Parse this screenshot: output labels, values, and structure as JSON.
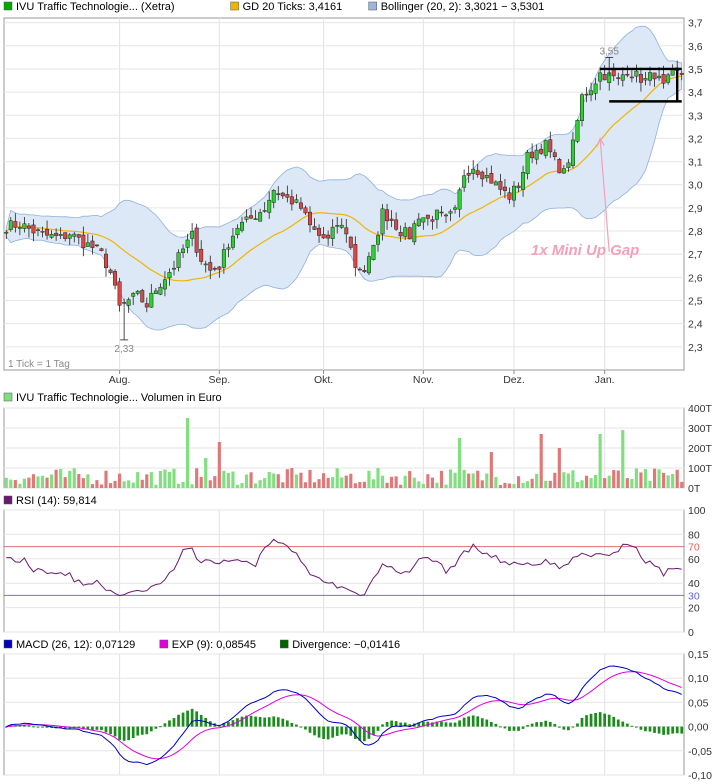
{
  "chart_data": [
    {
      "type": "candlestick",
      "legend": [
        {
          "name": "IVU Traffic Technologie... (Xetra)",
          "color": "#00aa00"
        },
        {
          "name": "GD 20 Ticks: 3,4161",
          "color": "#f0b400"
        },
        {
          "name": "Bollinger (20, 2): 3,3021 − 3,5301",
          "color": "#9bb6dc"
        }
      ],
      "tick_label": "1 Tick = 1 Tag",
      "y_ticks": [
        "3,7",
        "3,6",
        "3,5",
        "3,4",
        "3,3",
        "3,2",
        "3,1",
        "3,0",
        "2,9",
        "2,8",
        "2,7",
        "2,6",
        "2,5",
        "2,4",
        "2,3"
      ],
      "y_values": [
        3.7,
        3.6,
        3.5,
        3.4,
        3.3,
        3.2,
        3.1,
        3.0,
        2.9,
        2.8,
        2.7,
        2.6,
        2.5,
        2.4,
        2.3
      ],
      "ylim": [
        2.2,
        3.72
      ],
      "x_ticks": [
        "Aug.",
        "Sep.",
        "Okt.",
        "Nov.",
        "Dez.",
        "Jan."
      ],
      "x_tick_index": [
        25,
        47,
        70,
        92,
        112,
        132
      ],
      "annotations": {
        "low": "2,33",
        "high": "3,55",
        "text": "1x Mini Up Gap"
      },
      "anchors": [
        [
          0,
          2.82
        ],
        [
          3,
          2.83
        ],
        [
          6,
          2.8
        ],
        [
          9,
          2.78
        ],
        [
          12,
          2.77
        ],
        [
          14,
          2.79
        ],
        [
          17,
          2.75
        ],
        [
          19,
          2.73
        ],
        [
          21,
          2.7
        ],
        [
          23,
          2.62
        ],
        [
          25,
          2.47
        ],
        [
          27,
          2.5
        ],
        [
          29,
          2.52
        ],
        [
          31,
          2.48
        ],
        [
          33,
          2.55
        ],
        [
          35,
          2.6
        ],
        [
          37,
          2.65
        ],
        [
          39,
          2.72
        ],
        [
          41,
          2.78
        ],
        [
          43,
          2.68
        ],
        [
          45,
          2.63
        ],
        [
          47,
          2.65
        ],
        [
          49,
          2.75
        ],
        [
          51,
          2.82
        ],
        [
          53,
          2.84
        ],
        [
          55,
          2.87
        ],
        [
          57,
          2.9
        ],
        [
          59,
          2.98
        ],
        [
          61,
          2.95
        ],
        [
          63,
          2.93
        ],
        [
          65,
          2.9
        ],
        [
          67,
          2.82
        ],
        [
          69,
          2.78
        ],
        [
          71,
          2.76
        ],
        [
          73,
          2.83
        ],
        [
          75,
          2.8
        ],
        [
          77,
          2.65
        ],
        [
          79,
          2.63
        ],
        [
          81,
          2.72
        ],
        [
          83,
          2.88
        ],
        [
          85,
          2.85
        ],
        [
          87,
          2.8
        ],
        [
          89,
          2.78
        ],
        [
          91,
          2.87
        ],
        [
          93,
          2.85
        ],
        [
          95,
          2.87
        ],
        [
          97,
          2.85
        ],
        [
          99,
          2.88
        ],
        [
          101,
          3.05
        ],
        [
          103,
          3.08
        ],
        [
          105,
          3.05
        ],
        [
          107,
          3.02
        ],
        [
          109,
          2.98
        ],
        [
          111,
          2.95
        ],
        [
          113,
          3.0
        ],
        [
          115,
          3.12
        ],
        [
          117,
          3.15
        ],
        [
          119,
          3.17
        ],
        [
          121,
          3.1
        ],
        [
          123,
          3.05
        ],
        [
          125,
          3.17
        ],
        [
          127,
          3.38
        ],
        [
          129,
          3.42
        ],
        [
          131,
          3.48
        ],
        [
          133,
          3.47
        ],
        [
          135,
          3.45
        ],
        [
          137,
          3.5
        ],
        [
          139,
          3.47
        ],
        [
          141,
          3.45
        ],
        [
          143,
          3.48
        ],
        [
          145,
          3.42
        ],
        [
          147,
          3.48
        ]
      ]
    },
    {
      "type": "bar",
      "legend": [
        {
          "name": "IVU Traffic Technologie... Volumen in Euro",
          "color": "#80e080"
        }
      ],
      "y_ticks": [
        "400T",
        "300T",
        "200T",
        "100T",
        "0T"
      ],
      "y_values": [
        400,
        300,
        200,
        100,
        0
      ],
      "ylim": [
        0,
        400
      ]
    },
    {
      "type": "line",
      "legend": [
        {
          "name": "RSI (14): 59,814",
          "color": "#6a1a70"
        }
      ],
      "y_ticks": [
        "100",
        "80",
        "70",
        "60",
        "40",
        "30",
        "20",
        "0"
      ],
      "y_values": [
        100,
        80,
        70,
        60,
        40,
        30,
        20,
        0
      ],
      "ylim": [
        0,
        100
      ],
      "levels": {
        "upper": 70,
        "lower": 30
      }
    },
    {
      "type": "line",
      "legend": [
        {
          "name": "MACD (26, 12): 0,07129",
          "color": "#0000c0"
        },
        {
          "name": "EXP (9): 0,08545",
          "color": "#e000e0"
        },
        {
          "name": "Divergence: −0,01416",
          "color": "#006400"
        }
      ],
      "y_ticks": [
        "0,15",
        "0,10",
        "0,05",
        "0,00",
        "-0,05",
        "-0,10"
      ],
      "y_values": [
        0.15,
        0.1,
        0.05,
        0.0,
        -0.05,
        -0.1
      ],
      "ylim": [
        -0.1,
        0.15
      ]
    }
  ]
}
